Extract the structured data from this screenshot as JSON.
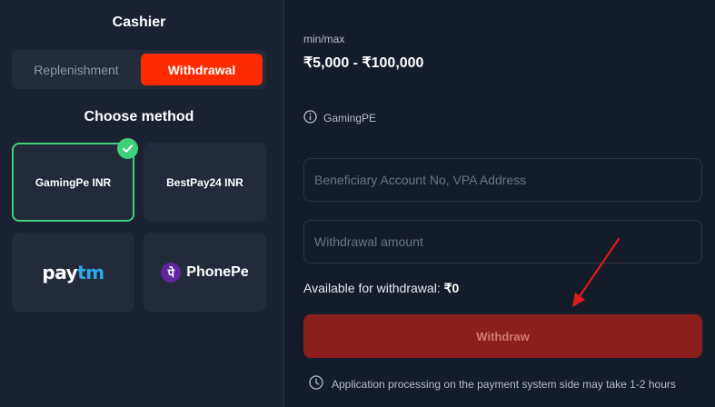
{
  "cashier": {
    "title": "Cashier",
    "tabs": [
      {
        "label": "Replenishment",
        "active": false
      },
      {
        "label": "Withdrawal",
        "active": true
      }
    ],
    "choose_method_title": "Choose method",
    "methods": [
      {
        "label": "GamingPe INR",
        "selected": true
      },
      {
        "label": "BestPay24 INR",
        "selected": false
      },
      {
        "label_pay": "pay",
        "label_tm": "tm",
        "logo": "paytm-logo",
        "selected": false
      },
      {
        "label": "PhonePe",
        "logo_glyph": "पे",
        "logo": "phonepe-logo",
        "selected": false
      }
    ]
  },
  "withdraw_form": {
    "minmax_label": "min/max",
    "minmax_value": "₹5,000 - ₹100,000",
    "provider_name": "GamingPE",
    "account_placeholder": "Beneficiary Account No, VPA Address",
    "amount_placeholder": "Withdrawal amount",
    "available_label": "Available for withdrawal: ",
    "available_value": "₹0",
    "withdraw_button": "Withdraw",
    "processing_note": "Application processing on the payment system side may take 1-2 hours"
  },
  "colors": {
    "accent": "#fe2b01",
    "selected_border": "#3fd07c",
    "withdraw_button": "#8b1f1c",
    "annotation_arrow": "#e0191b"
  }
}
